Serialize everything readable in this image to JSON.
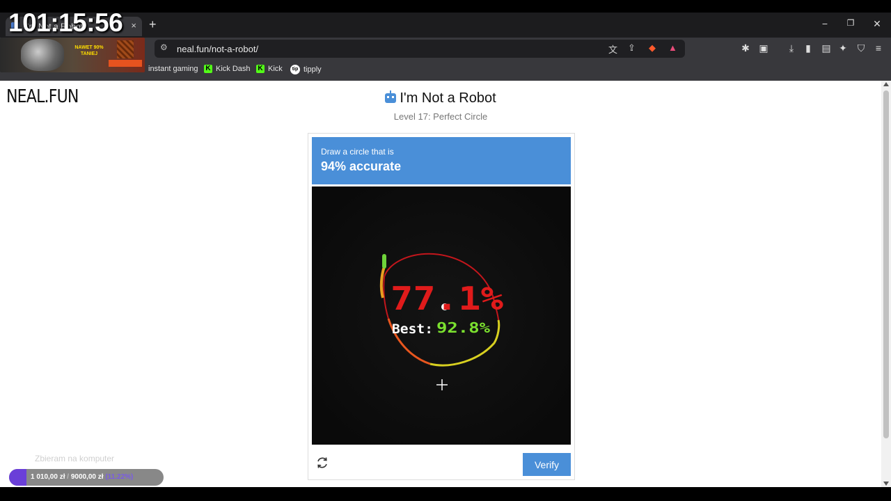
{
  "overlay": {
    "timer": "101:15:56",
    "donation": {
      "label": "Zbieram na komputer",
      "current": "1 010,00 zł",
      "separator": "/",
      "goal": "9000,00 zł",
      "percent": "(11.22%)",
      "fill_fraction": 0.1122
    },
    "ad": {
      "text": "NAWET 90% TANIEJ"
    }
  },
  "browser": {
    "tab_title": "I'm Not a Robot",
    "tab_close": "×",
    "new_tab": "+",
    "url": "neal.fun/not-a-robot/",
    "window_controls": {
      "minimize": "−",
      "maximize": "❐",
      "close": "✕"
    },
    "bookmarks": [
      {
        "label": "instant gaming"
      },
      {
        "label": "Kick Dash"
      },
      {
        "label": "Kick"
      },
      {
        "label": "tipply"
      }
    ]
  },
  "page": {
    "logo": "NEAL.FUN",
    "title": "I'm Not a Robot",
    "subtitle": "Level 17: Perfect Circle",
    "prompt_line1": "Draw a circle that is",
    "prompt_line2": "94% accurate",
    "verify_label": "Verify"
  },
  "game": {
    "score": "77.1%",
    "best_label": "Best:",
    "best_value": "92.8%",
    "colors": {
      "score": "#e01b1b",
      "best_value": "#7be02f",
      "best_label": "#ffffff",
      "accent": "#4a8fd8"
    }
  }
}
